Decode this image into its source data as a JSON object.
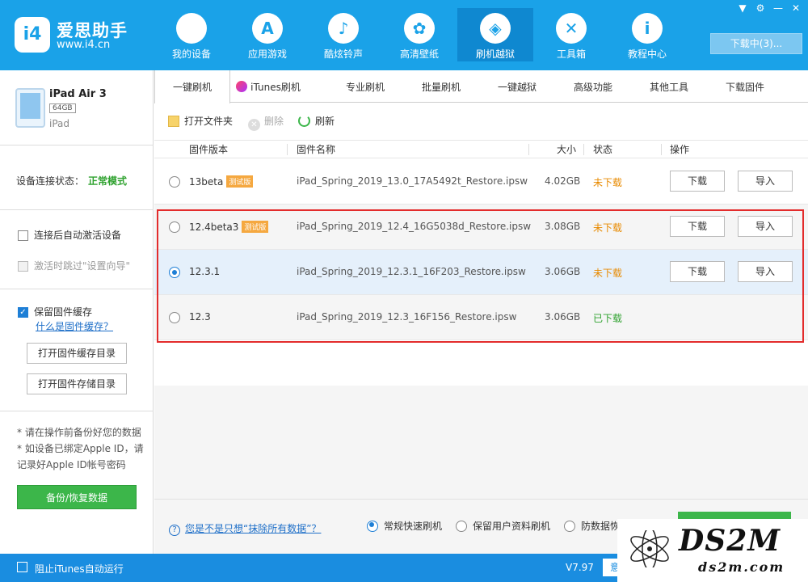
{
  "header": {
    "logo_mark": "i4",
    "logo_name": "爱思助手",
    "logo_url": "www.i4.cn",
    "nav": [
      {
        "label": "我的设备",
        "icon": "apple-icon",
        "glyph": ""
      },
      {
        "label": "应用游戏",
        "icon": "app-store-icon",
        "glyph": "A"
      },
      {
        "label": "酷炫铃声",
        "icon": "bell-icon",
        "glyph": "♪"
      },
      {
        "label": "高清壁纸",
        "icon": "flower-icon",
        "glyph": "✿"
      },
      {
        "label": "刷机越狱",
        "icon": "dropbox-icon",
        "glyph": "◈"
      },
      {
        "label": "工具箱",
        "icon": "tools-icon",
        "glyph": "✕"
      },
      {
        "label": "教程中心",
        "icon": "info-icon",
        "glyph": "i"
      }
    ],
    "active_nav": "刷机越狱",
    "download_button": "下载中(3)...",
    "window_controls": [
      "shirt-icon",
      "gear-icon",
      "minimize-icon",
      "close-icon"
    ]
  },
  "device": {
    "name": "iPad Air 3",
    "capacity": "64GB",
    "type": "iPad",
    "conn_label": "设备连接状态：",
    "conn_value": "正常模式"
  },
  "left_options": {
    "auto_activate": "连接后自动激活设备",
    "skip_setup": "激活时跳过\"设置向导\"",
    "keep_cache": "保留固件缓存",
    "cache_link": "什么是固件缓存？",
    "open_cache_dir": "打开固件缓存目录",
    "open_store_dir": "打开固件存储目录",
    "note1": "* 请在操作前备份好您的数据",
    "note2": "* 如设备已绑定Apple ID，请记录好Apple ID帐号密码",
    "backup_button": "备份/恢复数据"
  },
  "tabs": [
    "一键刷机",
    "iTunes刷机",
    "专业刷机",
    "批量刷机",
    "一键越狱",
    "高级功能",
    "其他工具",
    "下载固件"
  ],
  "active_tab": "一键刷机",
  "toolbar": {
    "open_folder": "打开文件夹",
    "delete": "删除",
    "refresh": "刷新"
  },
  "table": {
    "headers": {
      "version": "固件版本",
      "name": "固件名称",
      "size": "大小",
      "status": "状态",
      "action": "操作"
    },
    "rows": [
      {
        "version": "13beta",
        "beta": "测试版",
        "name": "iPad_Spring_2019_13.0_17A5492t_Restore.ipsw",
        "size": "4.02GB",
        "status": "未下载",
        "downloaded": false,
        "selected": false
      },
      {
        "version": "12.4beta3",
        "beta": "测试版",
        "name": "iPad_Spring_2019_12.4_16G5038d_Restore.ipsw",
        "size": "3.08GB",
        "status": "未下载",
        "downloaded": false,
        "selected": false
      },
      {
        "version": "12.3.1",
        "beta": "",
        "name": "iPad_Spring_2019_12.3.1_16F203_Restore.ipsw",
        "size": "3.06GB",
        "status": "未下载",
        "downloaded": false,
        "selected": true
      },
      {
        "version": "12.3",
        "beta": "",
        "name": "iPad_Spring_2019_12.3_16F156_Restore.ipsw",
        "size": "3.06GB",
        "status": "已下载",
        "downloaded": true,
        "selected": false
      }
    ],
    "download_label": "下载",
    "import_label": "导入"
  },
  "bottom": {
    "erase_question": "您是不是只想“抹除所有数据”？",
    "opt_quick": "常规快速刷机",
    "opt_keep": "保留用户资料刷机",
    "opt_recover": "防数据恢复刷机",
    "flash_button": "立即刷机"
  },
  "statusbar": {
    "block_itunes": "阻止iTunes自动运行",
    "version": "V7.97",
    "feedback": "意"
  },
  "watermark": {
    "big": "DS2M",
    "small": "ds2m.com"
  },
  "colors": {
    "brand_blue": "#1aa2e8",
    "green": "#3cb64a",
    "orange": "#e88a00",
    "highlight_red": "#e32c2c"
  }
}
